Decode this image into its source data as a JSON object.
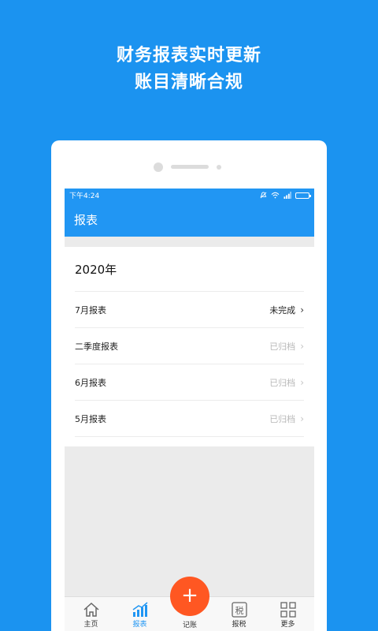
{
  "promo": {
    "line1": "财务报表实时更新",
    "line2": "账目清晰合规"
  },
  "statusbar": {
    "time": "下午4:24"
  },
  "appbar": {
    "title": "报表"
  },
  "reports": {
    "year": "2020年",
    "items": [
      {
        "label": "7月报表",
        "status": "未完成",
        "state": "pending"
      },
      {
        "label": "二季度报表",
        "status": "已归档",
        "state": "archived"
      },
      {
        "label": "6月报表",
        "status": "已归档",
        "state": "archived"
      },
      {
        "label": "5月报表",
        "status": "已归档",
        "state": "archived"
      }
    ]
  },
  "tabbar": {
    "home": "主页",
    "reports": "报表",
    "add_symbol": "+",
    "bookkeeping": "记账",
    "tax": "报税",
    "tax_icon_glyph": "税",
    "more": "更多"
  },
  "colors": {
    "brand_blue": "#2196f3",
    "background_blue": "#1b93f0",
    "fab_orange": "#ff5722"
  }
}
